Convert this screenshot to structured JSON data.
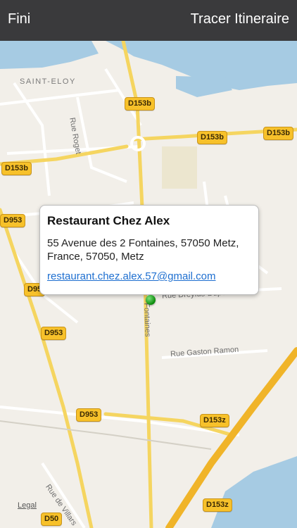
{
  "toolbar": {
    "done_label": "Fini",
    "route_label": "Tracer Itineraire"
  },
  "map": {
    "place_label": "SAINT-ELOY",
    "streets": {
      "rue_roget": "Rue Roget",
      "rue_dreyfus": "Rue Dreyfus-Dupont",
      "rue_fontaines": "Fontaines",
      "rue_gaston": "Rue Gaston Ramon",
      "rue_villars": "Rue de Villars"
    },
    "road_tags": {
      "d153b_top": "D153b",
      "d153b_mid": "D153b",
      "d153b_right": "D153b",
      "d153b_left": "D153b",
      "d953_left": "D953",
      "d95_left": "D95",
      "d953_mid": "D953",
      "d953_low": "D953",
      "d153z_mid": "D153z",
      "d153z_low": "D153z",
      "d50": "D50"
    },
    "legal_label": "Legal"
  },
  "callout": {
    "title": "Restaurant Chez Alex",
    "address": "55 Avenue des 2 Fontaines, 57050 Metz, France, 57050, Metz",
    "email": "restaurant.chez.alex.57@gmail.com"
  },
  "colors": {
    "water": "#a6cbe3",
    "major_road": "#f5d560",
    "minor_road": "#ffffff",
    "land": "#f2efe9",
    "pin": "#0a8a0a"
  },
  "icons": {
    "pin": "map-pin-icon"
  }
}
